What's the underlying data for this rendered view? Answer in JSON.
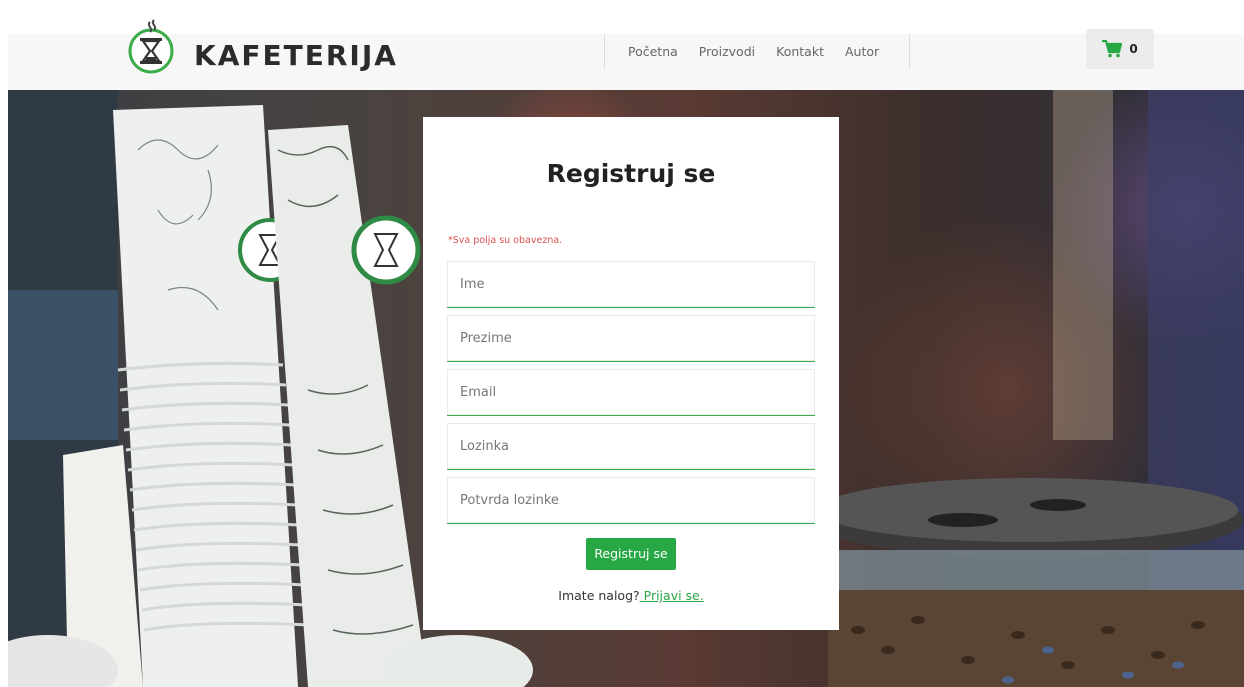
{
  "brand": {
    "name": "KAFETERIJA"
  },
  "nav": {
    "items": [
      "Početna",
      "Proizvodi",
      "Kontakt",
      "Autor"
    ]
  },
  "cart": {
    "count": "0",
    "icon": "shopping-cart-icon",
    "color": "#28a745"
  },
  "form": {
    "title": "Registruj se",
    "required_note": "*Sva polja su obavezna.",
    "fields": [
      {
        "placeholder": "Ime"
      },
      {
        "placeholder": "Prezime"
      },
      {
        "placeholder": "Email"
      },
      {
        "placeholder": "Lozinka"
      },
      {
        "placeholder": "Potvrda lozinke"
      }
    ],
    "submit_label": "Registruj se",
    "login_prompt": "Imate nalog?",
    "login_link": " Prijavi se."
  },
  "colors": {
    "accent": "#28a745",
    "error": "#d9534f"
  }
}
